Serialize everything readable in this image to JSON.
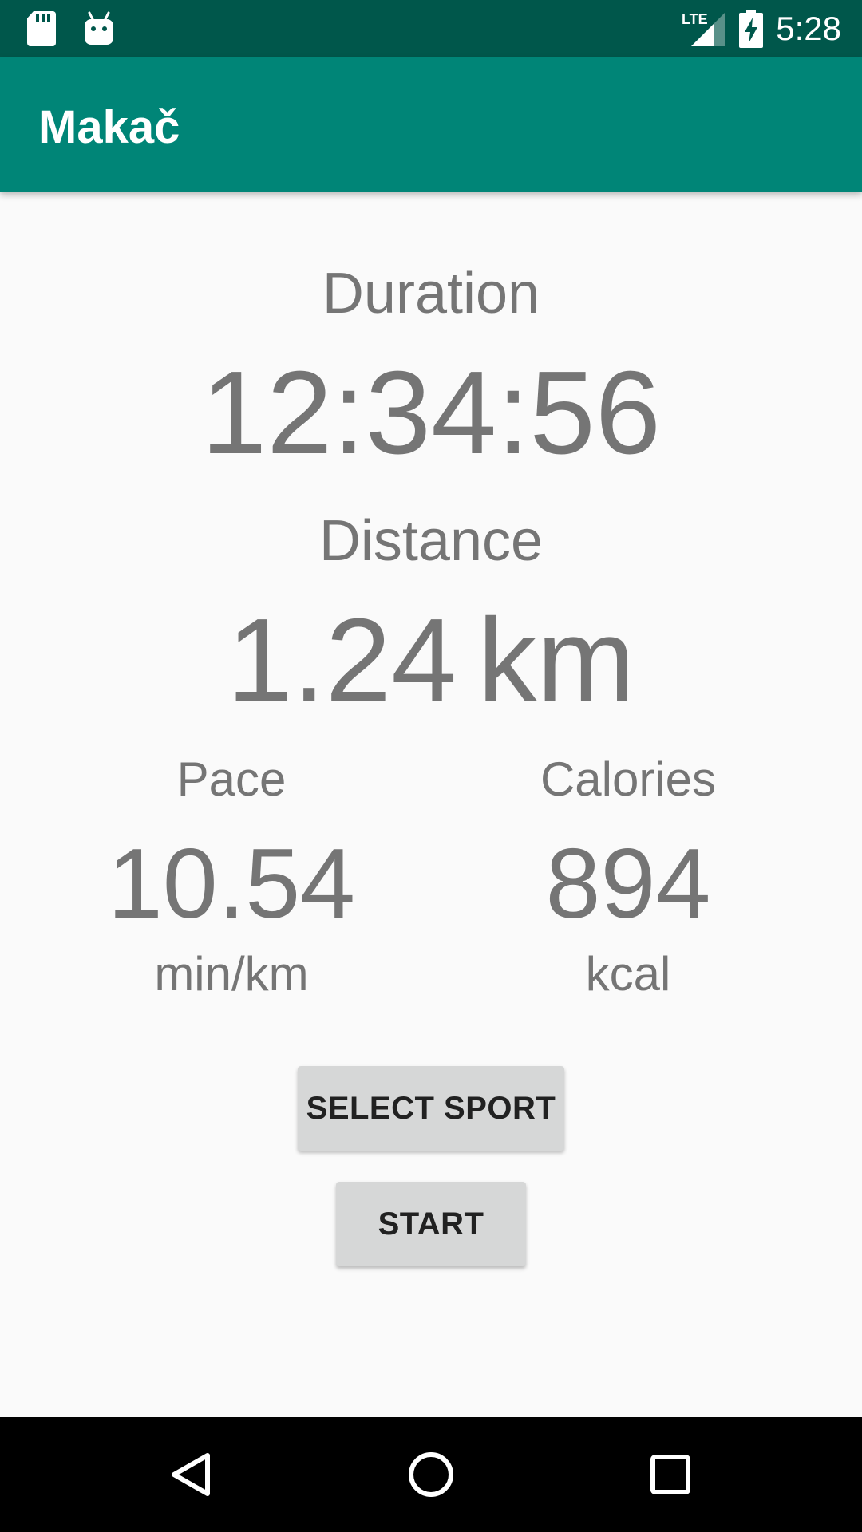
{
  "status_bar": {
    "time": "5:28",
    "left_icons": [
      "sd-card-icon",
      "android-debug-icon"
    ],
    "right_icons": [
      "lte-signal-icon",
      "battery-charging-icon"
    ],
    "network_label": "LTE"
  },
  "app_bar": {
    "title": "Makač"
  },
  "stats": {
    "duration": {
      "label": "Duration",
      "value": "12:34:56"
    },
    "distance": {
      "label": "Distance",
      "value": "1.24",
      "unit": "km"
    },
    "pace": {
      "label": "Pace",
      "value": "10.54",
      "unit": "min/km"
    },
    "calories": {
      "label": "Calories",
      "value": "894",
      "unit": "kcal"
    }
  },
  "buttons": {
    "select_sport": "SELECT SPORT",
    "start": "START"
  },
  "nav_bar": {
    "icons": [
      "back-icon",
      "home-icon",
      "recents-icon"
    ]
  },
  "colors": {
    "status_bar": "#00574b",
    "app_bar": "#008577",
    "background": "#fafafa",
    "text_secondary": "#757575",
    "button": "#d6d7d7",
    "nav_bar": "#000000"
  }
}
